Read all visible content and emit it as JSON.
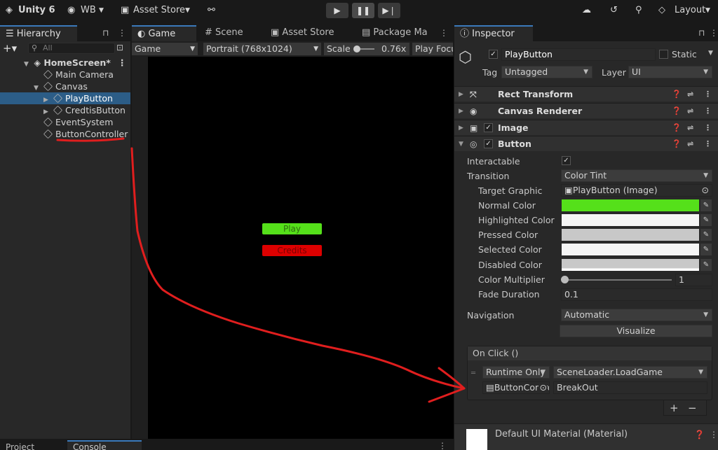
{
  "toolbar": {
    "app_title": "Unity 6",
    "account": "WB",
    "asset_store": "Asset Store",
    "layout": "Layout",
    "play_icon": "play-icon",
    "pause_icon": "pause-icon",
    "step_icon": "step-icon"
  },
  "hierarchy": {
    "tab": "Hierarchy",
    "search_placeholder": "All",
    "scene": "HomeScreen*",
    "rows": [
      "Main Camera",
      "Canvas",
      "PlayButton",
      "CredtisButton",
      "EventSystem",
      "ButtonController"
    ]
  },
  "game": {
    "tabs": [
      "Game",
      "Scene",
      "Asset Store",
      "Package Ma"
    ],
    "display": "Game",
    "resolution": "Portrait (768x1024)",
    "scale_label": "Scale",
    "scale_value": "0.76x",
    "scale_fraction": 0.1,
    "play_focus": "Play Focu",
    "play_button": "Play",
    "credits_button": "Credits"
  },
  "inspector": {
    "tab": "Inspector",
    "object_name": "PlayButton",
    "static_label": "Static",
    "tag_label": "Tag",
    "tag_value": "Untagged",
    "layer_label": "Layer",
    "layer_value": "UI",
    "components": [
      "Rect Transform",
      "Canvas Renderer",
      "Image",
      "Button"
    ],
    "button": {
      "interactable_label": "Interactable",
      "transition_label": "Transition",
      "transition_value": "Color Tint",
      "target_graphic_label": "Target Graphic",
      "target_graphic_value": "PlayButton (Image)",
      "normal_color_label": "Normal Color",
      "highlighted_color_label": "Highlighted Color",
      "pressed_color_label": "Pressed Color",
      "selected_color_label": "Selected Color",
      "disabled_color_label": "Disabled Color",
      "color_multiplier_label": "Color Multiplier",
      "color_multiplier_value": "1",
      "fade_duration_label": "Fade Duration",
      "fade_duration_value": "0.1",
      "navigation_label": "Navigation",
      "navigation_value": "Automatic",
      "visualize": "Visualize",
      "onclick_label": "On Click ()",
      "runtime_value": "Runtime Only",
      "function_value": "SceneLoader.LoadGame",
      "object_value": "ButtonController",
      "argument_value": "BreakOut"
    },
    "material": "Default UI Material (Material)"
  },
  "bottom": {
    "tabs": [
      "Project",
      "Console"
    ]
  },
  "colors": {
    "normal": "#55e01a",
    "highlighted": "#f5f5f5",
    "pressed": "#c8c8c8",
    "selected": "#f5f5f5",
    "disabled": "#c8c8c8",
    "credits": "#dd0000",
    "annotation": "#e01e1e",
    "selection": "#2c5d87"
  }
}
